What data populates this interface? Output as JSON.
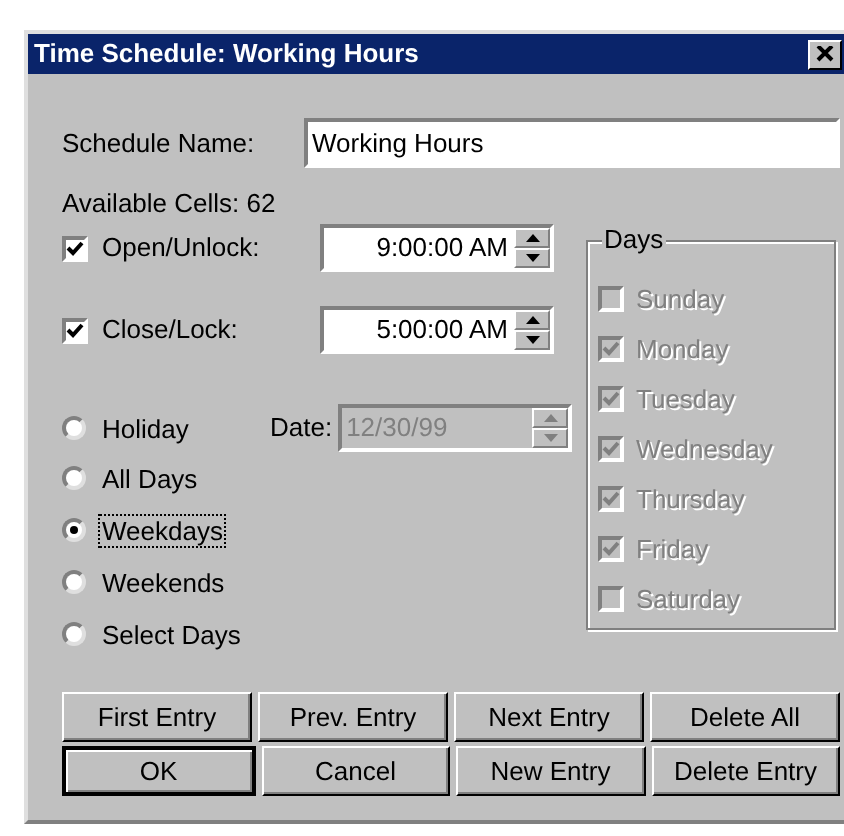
{
  "window": {
    "title": "Time Schedule: Working Hours"
  },
  "schedule_name": {
    "label": "Schedule Name:",
    "value": "Working Hours"
  },
  "available_cells": "Available Cells: 62",
  "times": [
    {
      "label": "Open/Unlock:",
      "checked": true,
      "value": "9:00:00 AM"
    },
    {
      "label": "Close/Lock:",
      "checked": true,
      "value": "5:00:00 AM"
    }
  ],
  "date": {
    "label": "Date:",
    "value": "12/30/99",
    "disabled": true
  },
  "day_types": [
    {
      "label": "Holiday",
      "selected": false,
      "focused": false
    },
    {
      "label": "All Days",
      "selected": false,
      "focused": false
    },
    {
      "label": "Weekdays",
      "selected": true,
      "focused": true
    },
    {
      "label": "Weekends",
      "selected": false,
      "focused": false
    },
    {
      "label": "Select Days",
      "selected": false,
      "focused": false
    }
  ],
  "days": {
    "title": "Days",
    "disabled": true,
    "items": [
      {
        "label": "Sunday",
        "checked": false
      },
      {
        "label": "Monday",
        "checked": true
      },
      {
        "label": "Tuesday",
        "checked": true
      },
      {
        "label": "Wednesday",
        "checked": true
      },
      {
        "label": "Thursday",
        "checked": true
      },
      {
        "label": "Friday",
        "checked": true
      },
      {
        "label": "Saturday",
        "checked": false
      }
    ]
  },
  "button_rows": [
    [
      {
        "label": "First Entry",
        "default": false
      },
      {
        "label": "Prev. Entry",
        "default": false
      },
      {
        "label": "Next Entry",
        "default": false
      },
      {
        "label": "Delete All",
        "default": false
      }
    ],
    [
      {
        "label": "OK",
        "default": true
      },
      {
        "label": "Cancel",
        "default": false
      },
      {
        "label": "New Entry",
        "default": false
      },
      {
        "label": "Delete Entry",
        "default": false
      }
    ]
  ]
}
